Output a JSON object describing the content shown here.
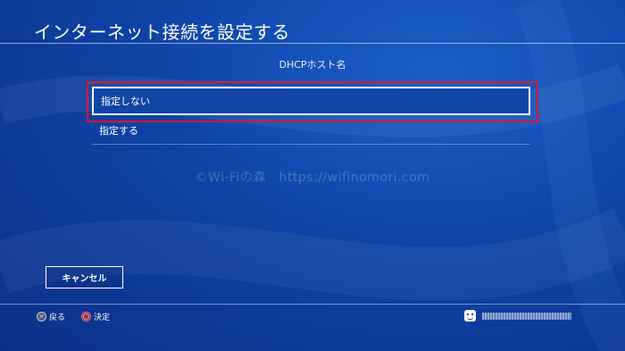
{
  "header": {
    "title": "インターネット接続を設定する"
  },
  "dialog": {
    "subtitle": "DHCPホスト名",
    "options": [
      {
        "label": "指定しない",
        "selected": true
      },
      {
        "label": "指定する",
        "selected": false
      }
    ]
  },
  "watermark": "©Wi-Fiの森　https://wifinomori.com",
  "footer": {
    "cancel_label": "キャンセル",
    "back_label": "戻る",
    "confirm_label": "決定"
  },
  "colors": {
    "highlight": "#e3162a",
    "background": "#0f44a8"
  }
}
